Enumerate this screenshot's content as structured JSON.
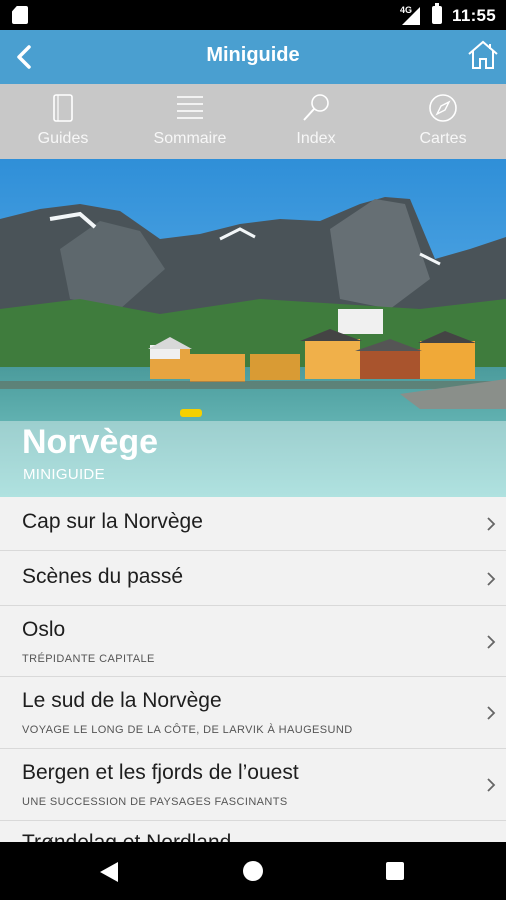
{
  "status_bar": {
    "network": "4G",
    "time": "11:55"
  },
  "app_bar": {
    "title": "Miniguide"
  },
  "tabs": [
    {
      "label": "Guides",
      "icon": "book-icon"
    },
    {
      "label": "Sommaire",
      "icon": "list-icon"
    },
    {
      "label": "Index",
      "icon": "magnifier-icon"
    },
    {
      "label": "Cartes",
      "icon": "compass-icon"
    }
  ],
  "hero": {
    "title": "Norvège",
    "subtitle": "MINIGUIDE"
  },
  "list": [
    {
      "title": "Cap sur la Norvège",
      "subtitle": ""
    },
    {
      "title": "Scènes du passé",
      "subtitle": ""
    },
    {
      "title": "Oslo",
      "subtitle": "TRÉPIDANTE CAPITALE"
    },
    {
      "title": "Le sud de la Norvège",
      "subtitle": "VOYAGE LE LONG DE LA CÔTE, DE LARVIK À HAUGESUND"
    },
    {
      "title": "Bergen et les fjords de l’ouest",
      "subtitle": "UNE SUCCESSION DE PAYSAGES FASCINANTS"
    },
    {
      "title": "Trøndelag et Nordland",
      "subtitle": ""
    }
  ]
}
